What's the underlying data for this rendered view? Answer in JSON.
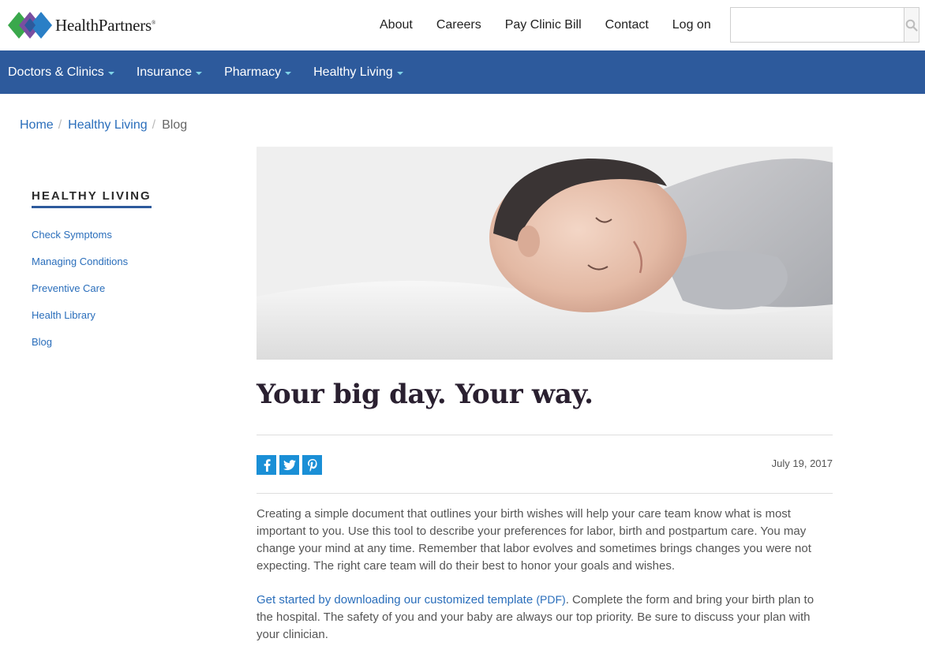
{
  "brand": {
    "name": "HealthPartners",
    "trademark": "®"
  },
  "top_nav": {
    "items": [
      "About",
      "Careers",
      "Pay Clinic Bill",
      "Contact",
      "Log on"
    ]
  },
  "search": {
    "placeholder": "",
    "value": "",
    "icon": "search-icon"
  },
  "main_nav": {
    "items": [
      "Doctors & Clinics",
      "Insurance",
      "Pharmacy",
      "Healthy Living"
    ],
    "accent": "#7fd3e8",
    "background": "#2d5a9c"
  },
  "breadcrumb": {
    "home": "Home",
    "section": "Healthy Living",
    "current": "Blog"
  },
  "sidebar": {
    "title": "HEALTHY LIVING",
    "items": [
      "Check Symptoms",
      "Managing Conditions",
      "Preventive Care",
      "Health Library",
      "Blog"
    ]
  },
  "article": {
    "title": "Your big day. Your way.",
    "date": "July 19, 2017",
    "social": [
      "facebook-icon",
      "twitter-icon",
      "pinterest-icon"
    ],
    "paragraph1": "Creating a simple document that outlines your birth wishes will help your care team know what is most important to you. Use this tool to describe your preferences for labor, birth and postpartum care. You may change your mind at any time. Remember that labor evolves and sometimes brings changes you were not expecting. The right care team will do their best to honor your goals and wishes.",
    "paragraph2_link": "Get started by downloading our customized template",
    "paragraph2_pdf": "(PDF)",
    "paragraph2_rest": ". Complete the form and bring your birth plan to the hospital. The safety of you and your baby are always our top priority. Be sure to discuss your plan with your clinician."
  }
}
